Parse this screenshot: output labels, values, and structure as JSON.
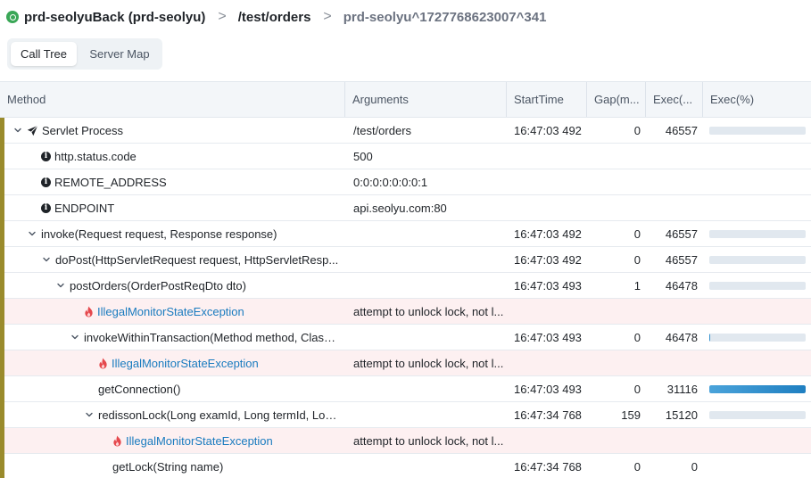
{
  "breadcrumb": {
    "app": "prd-seolyuBack (prd-seolyu)",
    "path": "/test/orders",
    "transaction": "prd-seolyu^1727768623007^341",
    "separator": ">"
  },
  "tabs": [
    {
      "label": "Call Tree",
      "active": true
    },
    {
      "label": "Server Map",
      "active": false
    }
  ],
  "columns": [
    "Method",
    "Arguments",
    "StartTime",
    "Gap(m...",
    "Exec(...",
    "Exec(%)"
  ],
  "colors": {
    "exception_text": "#1a7bbf",
    "exception_row_bg": "#fdf0f1",
    "depth_marker": "#9a8b2c",
    "bar_fill": "#1f7fc1"
  },
  "rows": [
    {
      "depth": 0,
      "icon": "send-icon",
      "expand": true,
      "method": "Servlet Process",
      "args": "/test/orders",
      "start": "16:47:03 492",
      "gap": "0",
      "exec": "46557",
      "exec_pct": 0,
      "error": false
    },
    {
      "depth": 1,
      "icon": "info-icon",
      "expand": false,
      "method": "http.status.code",
      "args": "500",
      "start": "",
      "gap": "",
      "exec": "",
      "exec_pct": null,
      "error": false
    },
    {
      "depth": 1,
      "icon": "info-icon",
      "expand": false,
      "method": "REMOTE_ADDRESS",
      "args": "0:0:0:0:0:0:0:1",
      "start": "",
      "gap": "",
      "exec": "",
      "exec_pct": null,
      "error": false
    },
    {
      "depth": 1,
      "icon": "info-icon",
      "expand": false,
      "method": "ENDPOINT",
      "args": "api.seolyu.com:80",
      "start": "",
      "gap": "",
      "exec": "",
      "exec_pct": null,
      "error": false
    },
    {
      "depth": 1,
      "icon": "",
      "expand": true,
      "method": "invoke(Request request, Response response)",
      "args": "",
      "start": "16:47:03 492",
      "gap": "0",
      "exec": "46557",
      "exec_pct": 0,
      "error": false
    },
    {
      "depth": 2,
      "icon": "",
      "expand": true,
      "method": "doPost(HttpServletRequest request, HttpServletResp...",
      "args": "",
      "start": "16:47:03 492",
      "gap": "0",
      "exec": "46557",
      "exec_pct": 0,
      "error": false
    },
    {
      "depth": 3,
      "icon": "",
      "expand": true,
      "method": "postOrders(OrderPostReqDto dto)",
      "args": "",
      "start": "16:47:03 493",
      "gap": "1",
      "exec": "46478",
      "exec_pct": 0,
      "error": false
    },
    {
      "depth": 4,
      "icon": "fire-icon",
      "expand": false,
      "method": "IllegalMonitorStateException",
      "args": "attempt to unlock lock, not l...",
      "start": "",
      "gap": "",
      "exec": "",
      "exec_pct": null,
      "error": true
    },
    {
      "depth": 4,
      "icon": "",
      "expand": true,
      "method": "invokeWithinTransaction(Method method, Class ...",
      "args": "",
      "start": "16:47:03 493",
      "gap": "0",
      "exec": "46478",
      "exec_pct": 1,
      "error": false
    },
    {
      "depth": 5,
      "icon": "fire-icon",
      "expand": false,
      "method": "IllegalMonitorStateException",
      "args": "attempt to unlock lock, not l...",
      "start": "",
      "gap": "",
      "exec": "",
      "exec_pct": null,
      "error": true
    },
    {
      "depth": 5,
      "icon": "",
      "expand": false,
      "method": "getConnection()",
      "args": "",
      "start": "16:47:03 493",
      "gap": "0",
      "exec": "31116",
      "exec_pct": 100,
      "error": false
    },
    {
      "depth": 5,
      "icon": "",
      "expand": true,
      "method": "redissonLock(Long examId, Long termId, Lon...",
      "args": "",
      "start": "16:47:34 768",
      "gap": "159",
      "exec": "15120",
      "exec_pct": 0,
      "error": false
    },
    {
      "depth": 6,
      "icon": "fire-icon",
      "expand": false,
      "method": "IllegalMonitorStateException",
      "args": "attempt to unlock lock, not l...",
      "start": "",
      "gap": "",
      "exec": "",
      "exec_pct": null,
      "error": true
    },
    {
      "depth": 6,
      "icon": "",
      "expand": false,
      "method": "getLock(String name)",
      "args": "",
      "start": "16:47:34 768",
      "gap": "0",
      "exec": "0",
      "exec_pct": null,
      "error": false
    }
  ]
}
